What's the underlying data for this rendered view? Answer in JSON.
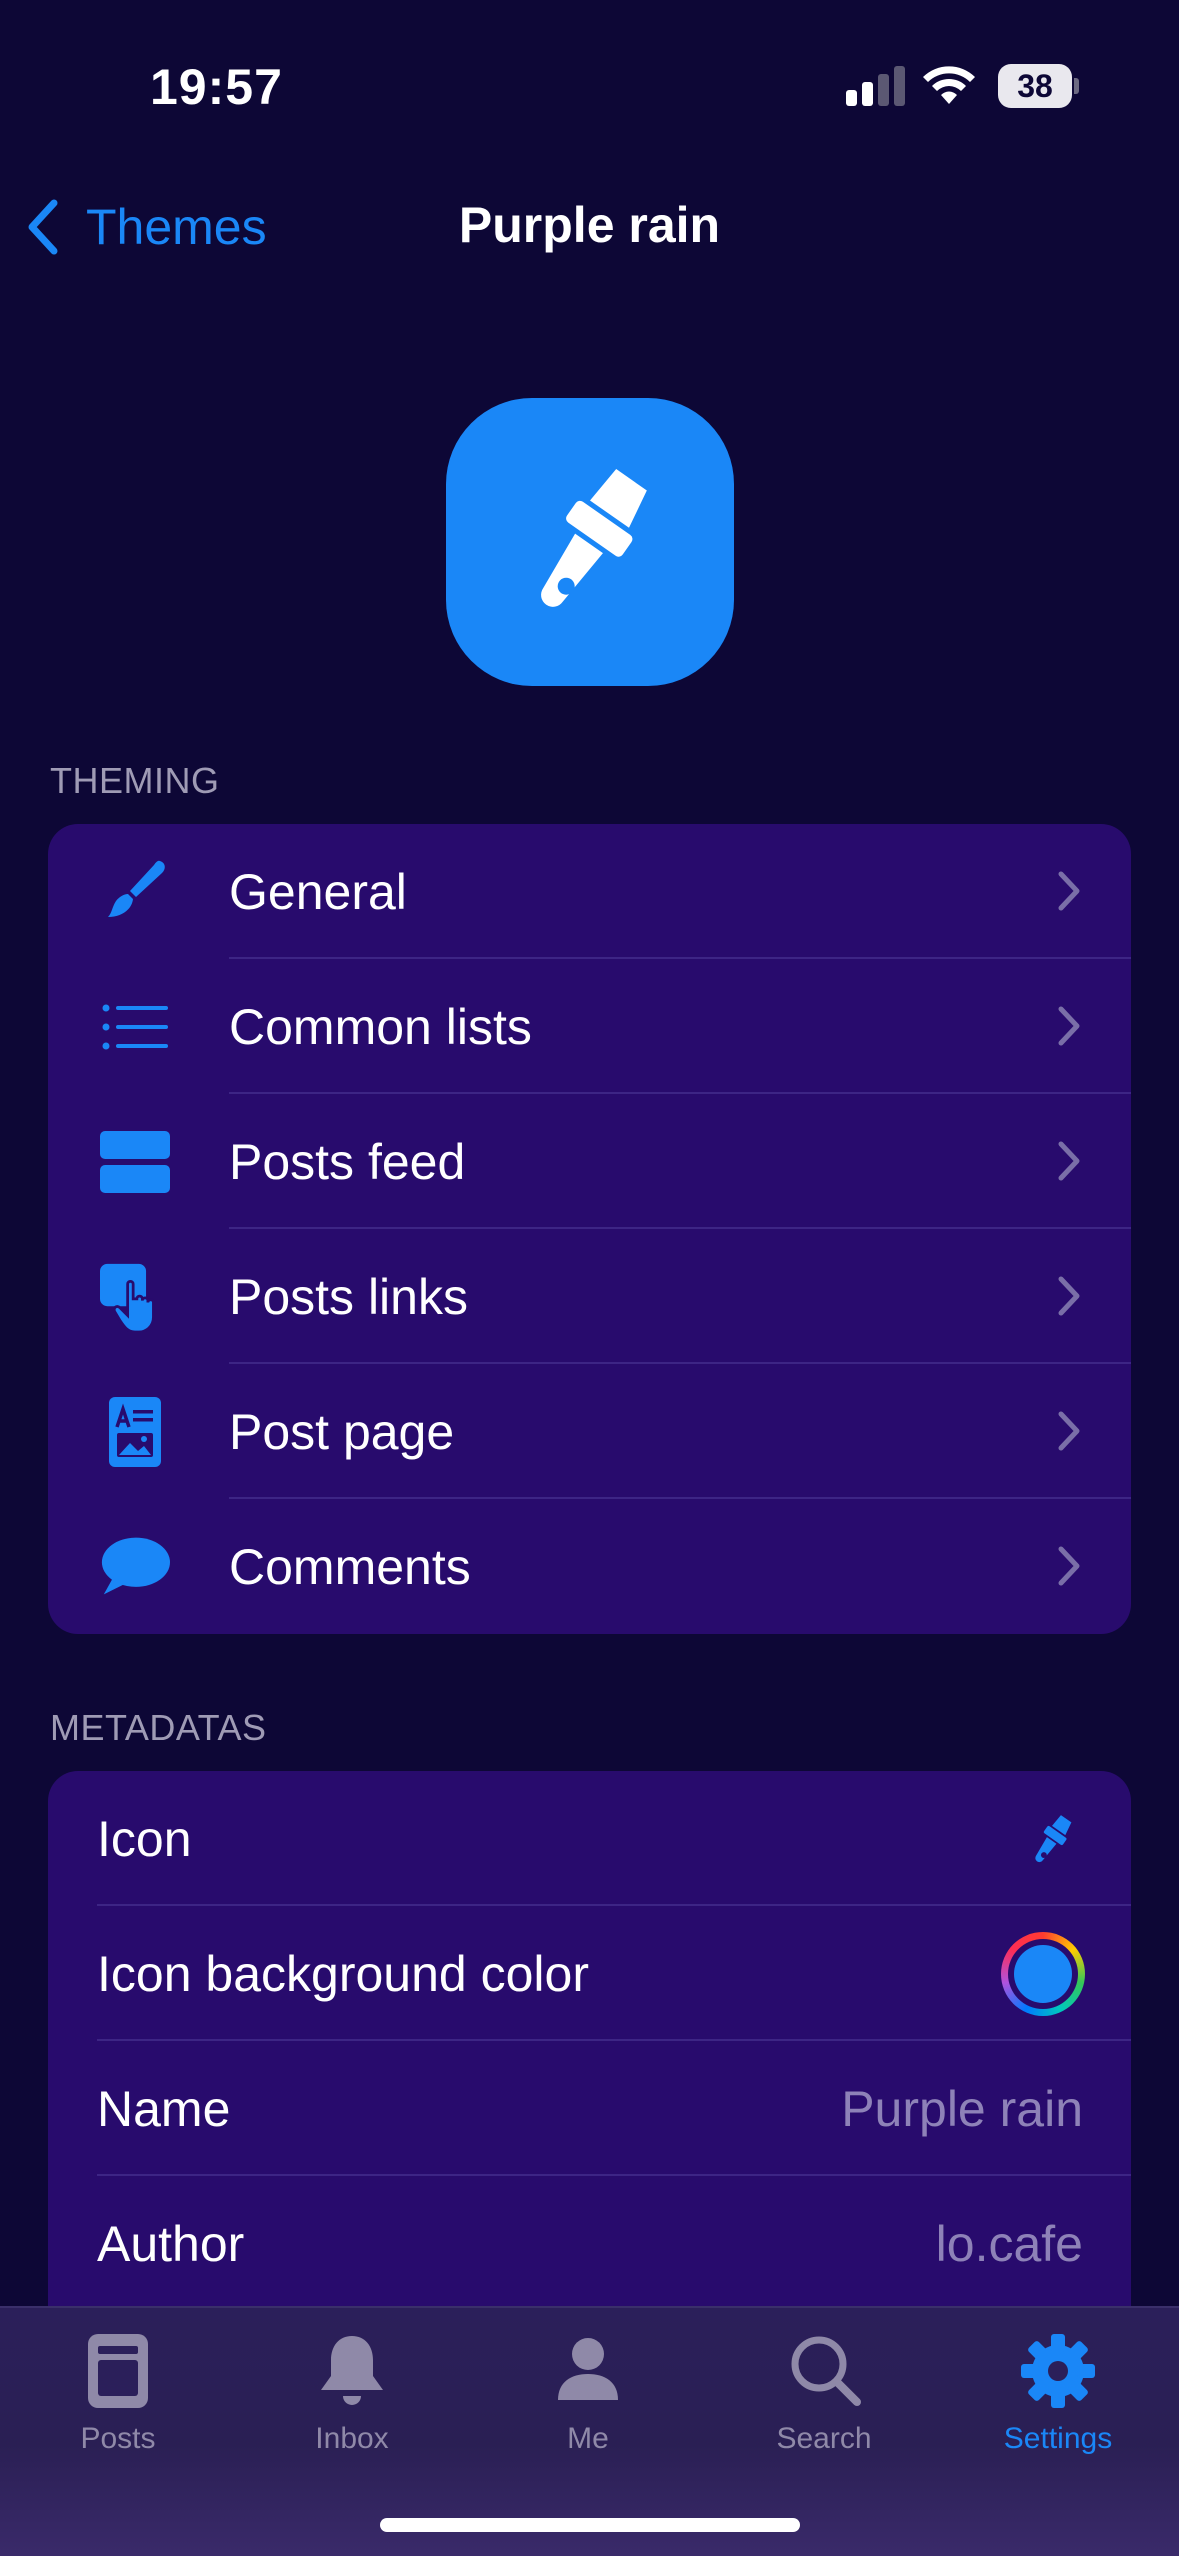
{
  "status_bar": {
    "time": "19:57",
    "battery": "38"
  },
  "nav": {
    "back_label": "Themes",
    "title": "Purple rain"
  },
  "hero": {
    "icon": "paintbrush-icon",
    "background_color": "#1a87f7"
  },
  "theming": {
    "header": "THEMING",
    "items": [
      {
        "label": "General",
        "icon": "paintbrush-icon"
      },
      {
        "label": "Common lists",
        "icon": "list-bullet-icon"
      },
      {
        "label": "Posts feed",
        "icon": "stacked-rectangles-icon"
      },
      {
        "label": "Posts links",
        "icon": "hand-tap-icon"
      },
      {
        "label": "Post page",
        "icon": "doc-text-image-icon"
      },
      {
        "label": "Comments",
        "icon": "speech-bubble-icon"
      }
    ]
  },
  "metadatas": {
    "header": "METADATAS",
    "items": [
      {
        "label": "Icon",
        "value": ""
      },
      {
        "label": "Icon background color",
        "value": ""
      },
      {
        "label": "Name",
        "value": "Purple rain"
      },
      {
        "label": "Author",
        "value": "lo.cafe"
      }
    ]
  },
  "tab_bar": {
    "tabs": [
      {
        "label": "Posts",
        "icon": "posts-icon",
        "active": false
      },
      {
        "label": "Inbox",
        "icon": "bell-icon",
        "active": false
      },
      {
        "label": "Me",
        "icon": "person-icon",
        "active": false
      },
      {
        "label": "Search",
        "icon": "magnifier-icon",
        "active": false
      },
      {
        "label": "Settings",
        "icon": "gear-icon",
        "active": true
      }
    ]
  },
  "colors": {
    "background": "#0d0736",
    "card": "#280b6d",
    "accent": "#1a87f7",
    "secondary_text": "#8e82b8"
  }
}
